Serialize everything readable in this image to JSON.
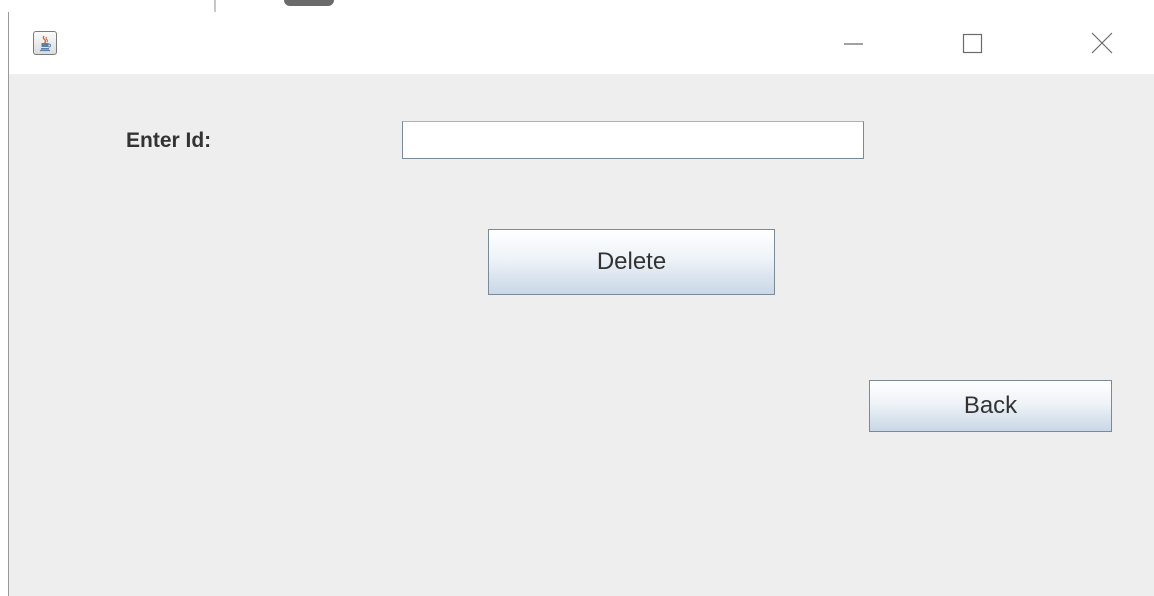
{
  "window": {
    "title": "",
    "app_icon": "java-icon",
    "controls": {
      "minimize_icon": "minimize-icon",
      "maximize_icon": "maximize-icon",
      "close_icon": "close-icon"
    }
  },
  "form": {
    "id_label": "Enter Id:",
    "id_value": "",
    "id_placeholder": "",
    "delete_label": "Delete",
    "back_label": "Back"
  },
  "colors": {
    "window_bg": "#eeeeee",
    "titlebar_bg": "#ffffff",
    "button_border": "#7a8a99",
    "button_gradient_bottom": "#c9d7e6",
    "text": "#333333"
  }
}
